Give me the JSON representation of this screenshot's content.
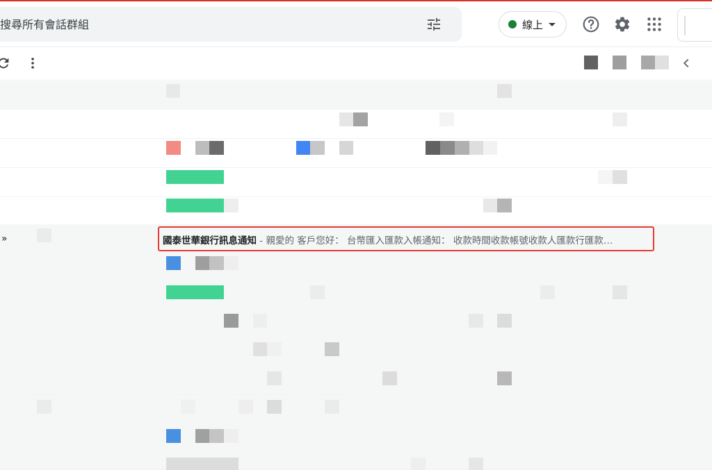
{
  "search": {
    "placeholder": "搜尋所有會話群組"
  },
  "status": {
    "label": "線上",
    "color": "#188038"
  },
  "icons": {
    "tune": "tune-icon",
    "help": "help-icon",
    "settings": "gear-icon",
    "apps": "apps-icon",
    "refresh": "refresh-icon",
    "more": "more-vert-icon",
    "prev": "chevron-left-icon"
  },
  "highlighted_email": {
    "marker": "»",
    "sender": "國泰世華銀行訊息通知",
    "separator": " - ",
    "snippet": "親愛的 客戶您好： 台幣匯入匯款入帳通知： 收款時間收款帳號收款人匯款行匯款…",
    "highlight_color": "#e53935"
  },
  "colors": {
    "accent_red": "#d93025",
    "label_green": "#42d392",
    "label_blue": "#4285f4",
    "label_salmon": "#f28b82",
    "pixel_dark": "#616161",
    "pixel_mid": "#9e9e9e",
    "pixel_light": "#e0e0e0"
  }
}
